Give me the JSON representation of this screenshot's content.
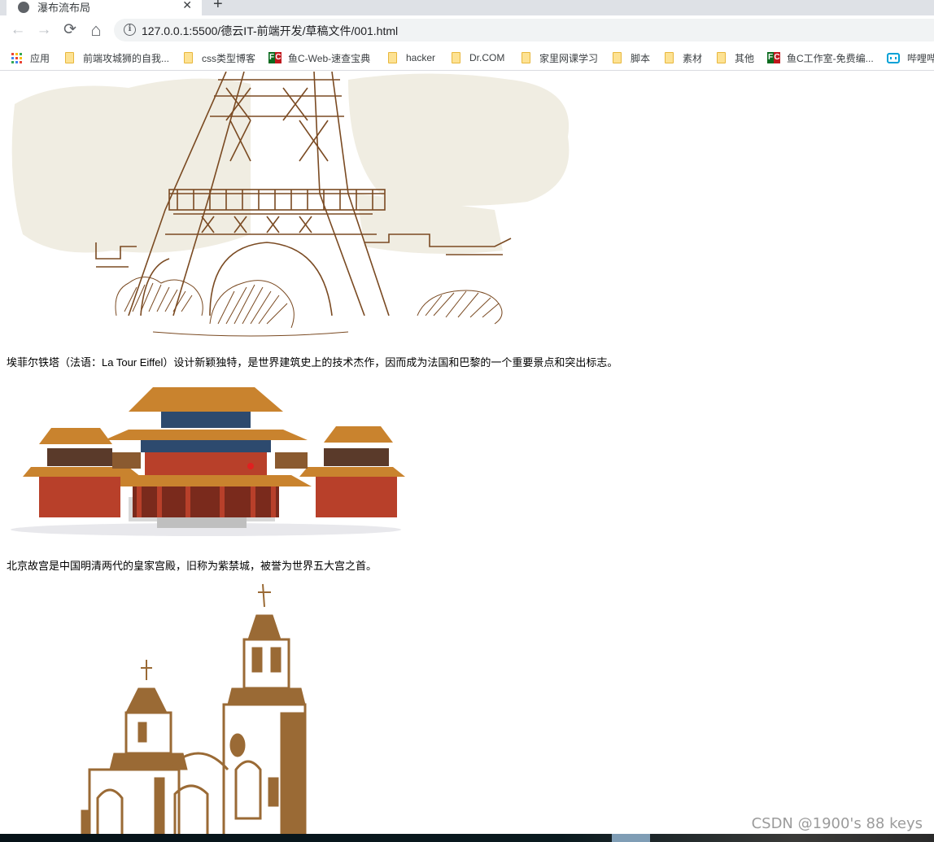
{
  "browser": {
    "tab": {
      "title": "瀑布流布局",
      "close_label": "✕",
      "favicon": "globe-icon"
    },
    "new_tab_label": "+",
    "nav": {
      "back": "←",
      "forward": "→",
      "reload": "⟳",
      "home": "⌂"
    },
    "omnibox": {
      "info_icon": "i",
      "url": "127.0.0.1:5500/德云IT-前端开发/草稿文件/001.html"
    },
    "bookmarks": [
      {
        "label": "应用",
        "icon": "apps-icon"
      },
      {
        "label": "前端攻城狮的自我...",
        "icon": "folder-icon"
      },
      {
        "label": "css类型博客",
        "icon": "folder-icon"
      },
      {
        "label": "鱼C-Web-速查宝典",
        "icon": "fc-icon"
      },
      {
        "label": "hacker",
        "icon": "folder-icon"
      },
      {
        "label": "Dr.COM",
        "icon": "folder-icon"
      },
      {
        "label": "家里网课学习",
        "icon": "folder-icon"
      },
      {
        "label": "脚本",
        "icon": "folder-icon"
      },
      {
        "label": "素材",
        "icon": "folder-icon"
      },
      {
        "label": "其他",
        "icon": "folder-icon"
      },
      {
        "label": "鱼C工作室-免费编...",
        "icon": "fc-icon"
      },
      {
        "label": "哔哩哔",
        "icon": "bilibili-icon"
      }
    ]
  },
  "page": {
    "items": [
      {
        "image": "eiffel-tower-sketch",
        "caption": "埃菲尔铁塔（法语：La Tour Eiffel）设计新颖独特，是世界建筑史上的技术杰作，因而成为法国和巴黎的一个重要景点和突出标志。"
      },
      {
        "image": "forbidden-city-palace",
        "caption": "北京故宫是中国明清两代的皇家宫殿，旧称为紫禁城，被誉为世界五大宫之首。"
      },
      {
        "image": "church-towers-sketch",
        "caption": ""
      }
    ]
  },
  "watermark": "CSDN @1900's 88 keys",
  "colors": {
    "sketch_brown": "#7a4a22",
    "sketch_bg": "#f0ede2",
    "church_brown": "#9a6a35",
    "roof_orange": "#c9832e",
    "wall_red": "#b8402a"
  }
}
